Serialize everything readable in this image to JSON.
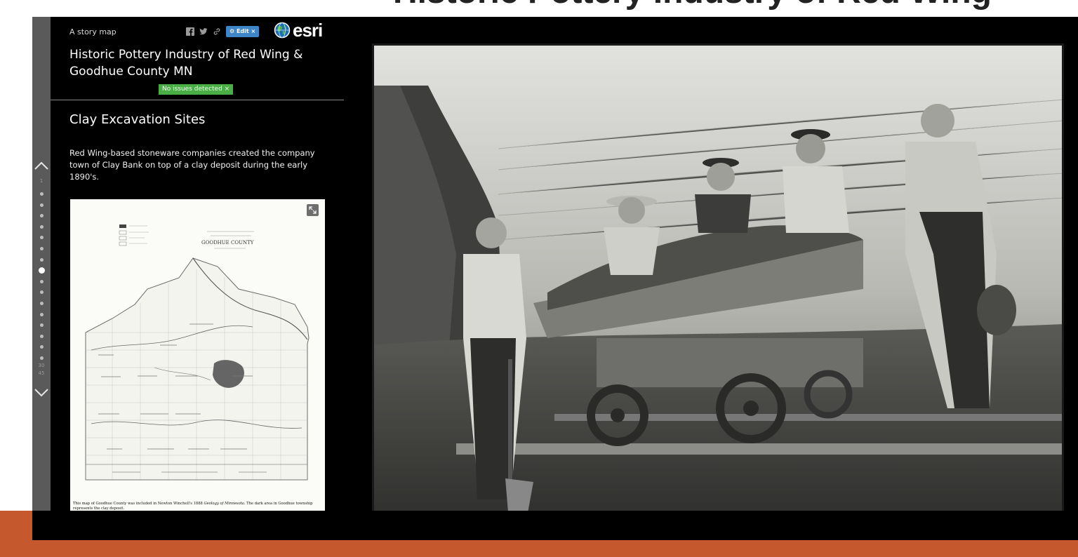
{
  "slide": {
    "title": "Historic Pottery Industry of Red Wing",
    "band_color": "#c5582d"
  },
  "nav": {
    "up_icon": "chevron-up-icon",
    "down_icon": "chevron-down-icon",
    "top_number": "1",
    "bottom_numbers": [
      "30",
      "45"
    ],
    "dot_count": 16,
    "active_index": 7
  },
  "header": {
    "label": "A story map",
    "share_icons": [
      "facebook-icon",
      "twitter-icon",
      "link-icon"
    ],
    "edit_label": "⚙ Edit ×",
    "logo_text": "esri",
    "title": "Historic Pottery Industry of Red Wing & Goodhue County MN",
    "issues_label": "No issues detected ×"
  },
  "section": {
    "title": "Clay Excavation Sites",
    "text": "Red Wing-based stoneware companies created the company town of Clay Bank on top of a clay deposit during the early 1890's."
  },
  "map_card": {
    "expand_icon": "expand-icon",
    "map_title": "GOODHUE COUNTY",
    "caption_start": "This map of Goodhue County was included in Newton Winchell's 1888 ",
    "caption_italic": "Geology of Minnesota",
    "caption_end": ". The dark area in Goodhue township represents the clay deposit."
  },
  "photo": {
    "description_icon": "historic-photo-icon"
  }
}
